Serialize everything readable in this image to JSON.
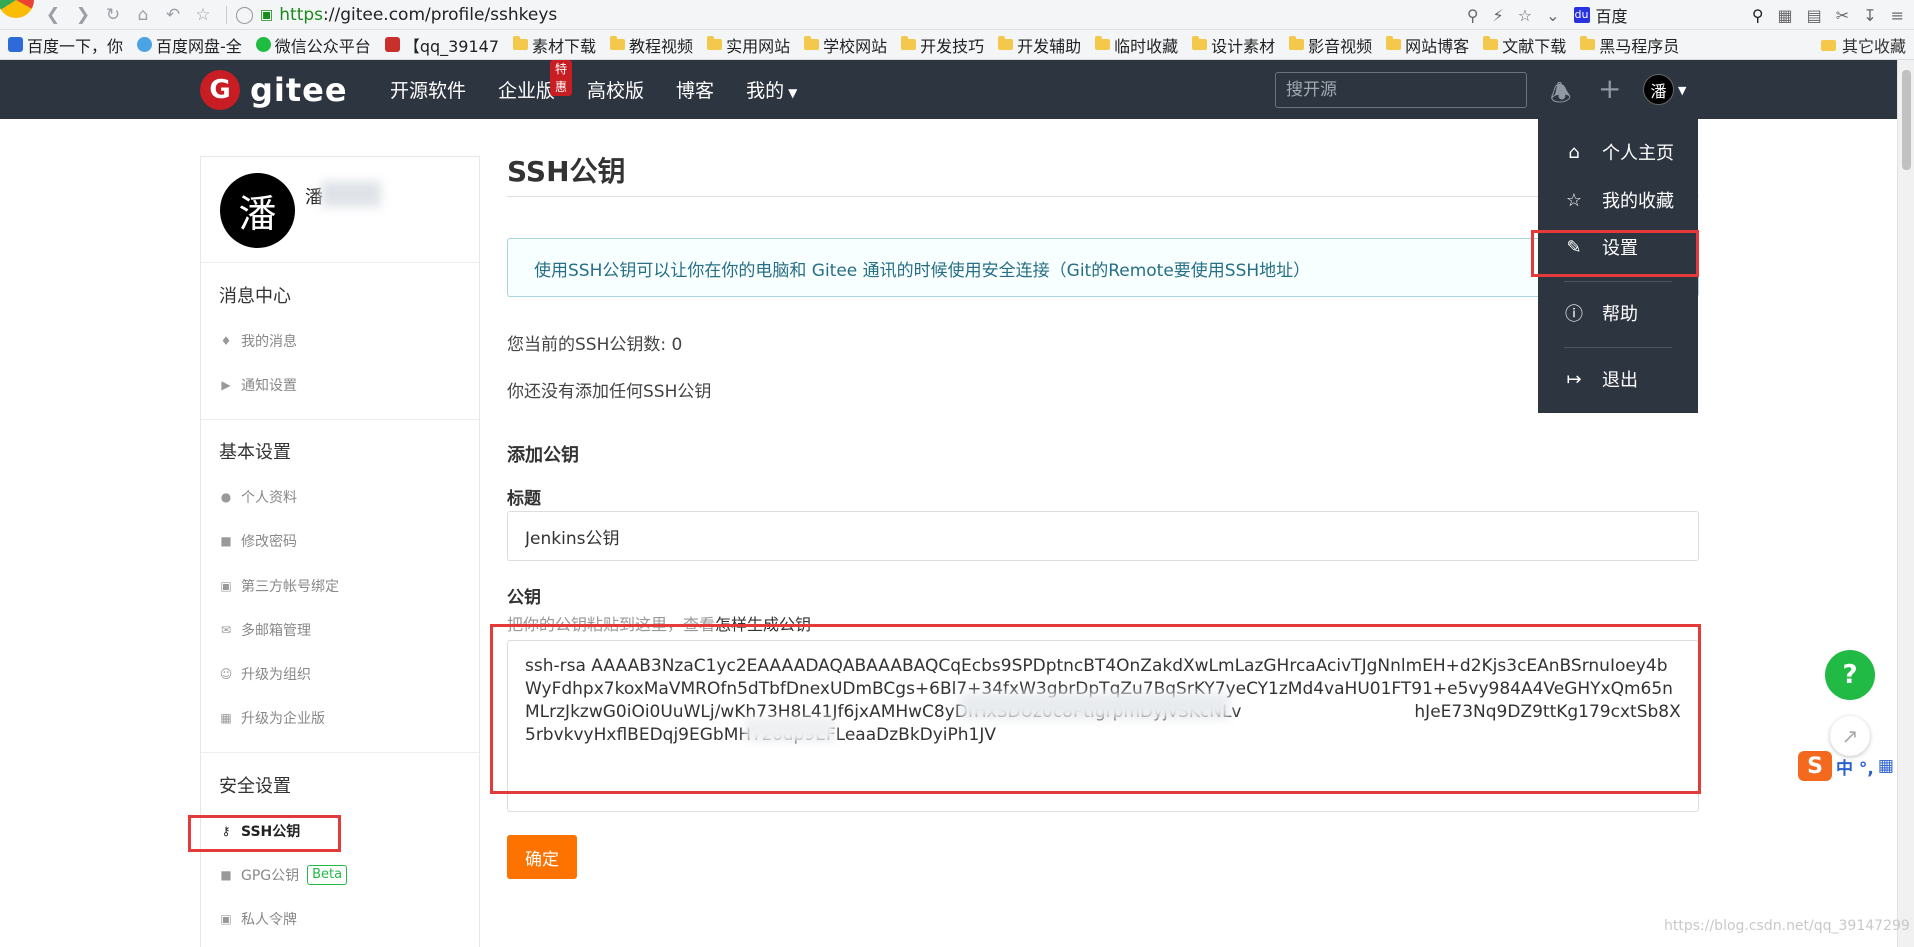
{
  "browser": {
    "url_scheme": "https",
    "url_rest": "://gitee.com/profile/sshkeys",
    "search_engine": "百度",
    "bookmarks": [
      "百度一下，你",
      "百度网盘-全",
      "微信公众平台",
      "【qq_39147",
      "素材下载",
      "教程视频",
      "实用网站",
      "学校网站",
      "开发技巧",
      "开发辅助",
      "临时收藏",
      "设计素材",
      "影音视频",
      "网站博客",
      "文献下载",
      "黑马程序员"
    ],
    "other_bookmarks": "其它收藏"
  },
  "header": {
    "logo": "gitee",
    "nav": [
      "开源软件",
      "企业版",
      "高校版",
      "博客",
      "我的"
    ],
    "hot_badge": "特惠",
    "search_placeholder": "搜开源",
    "avatar_char": "潘"
  },
  "dropdown": {
    "items": [
      "个人主页",
      "我的收藏",
      "设置",
      "帮助",
      "退出"
    ]
  },
  "sidebar": {
    "avatar_char": "潘",
    "username": "潘",
    "sections": [
      {
        "title": "消息中心",
        "items": [
          "我的消息",
          "通知设置"
        ]
      },
      {
        "title": "基本设置",
        "items": [
          "个人资料",
          "修改密码",
          "第三方帐号绑定",
          "多邮箱管理",
          "升级为组织",
          "升级为企业版"
        ]
      },
      {
        "title": "安全设置",
        "items": [
          "SSH公钥",
          "GPG公钥",
          "私人令牌"
        ]
      }
    ],
    "beta_badge": "Beta"
  },
  "main": {
    "title": "SSH公钥",
    "info": "使用SSH公钥可以让你在你的电脑和 Gitee 通讯的时候使用安全连接（Git的Remote要使用SSH地址）",
    "count_text": "您当前的SSH公钥数: 0",
    "empty_text": "你还没有添加任何SSH公钥",
    "add_title": "添加公钥",
    "title_label": "标题",
    "title_value": "Jenkins公钥",
    "key_label": "公钥",
    "help_text": "把你的公钥粘贴到这里，查看",
    "help_link": "怎样生成公钥",
    "key_value": "ssh-rsa AAAAB3NzaC1yc2EAAAADAQABAAABAQCqEcbs9SPDptncBT4OnZakdXwLmLazGHrcaAcivTJgNnlmEH+d2Kjs3cEAnBSrnuIoey4bWyFdhpx7koxMaVMROfn5dTbfDnexUDmBCgs+6Bl7+34fxW3gbrDpTqZu7BqSrKY7yeCY1zMd4vaHU01FT91+e5vy984A4VeGHYxQm65nMLrzJkzwG0iOi0UuWLj/wKh73H8L41Jf6jxAMHwC8yDfHxSDUz0c8PtIgrpmDyjvSKcNLv                                hJeE73Nq9DZ9ttKg179cxtSb8X5rbvkvyHxflBEDqj9EGbMHY2odp9EFLeaaDzBkDyiPh1JV",
    "submit_label": "确定"
  },
  "floating": {
    "help": "?",
    "ime_text": "中 °,"
  },
  "watermark": "https://blog.csdn.net/qq_39147299",
  "colors": {
    "header_bg": "#2d3540",
    "brand_red": "#c71d23",
    "submit_orange": "#fe7300",
    "highlight_red": "#e43a3a",
    "help_green": "#21ba45"
  }
}
